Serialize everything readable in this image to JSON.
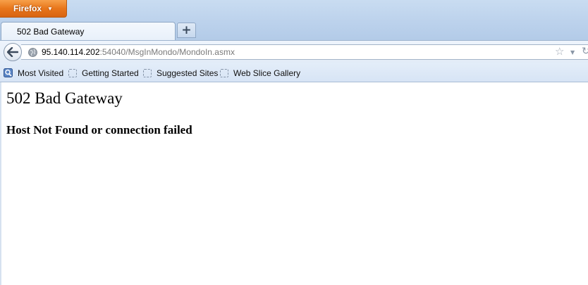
{
  "browser": {
    "menu_button_label": "Firefox",
    "accent_orange": "#e8761b"
  },
  "tabs": [
    {
      "title": "502 Bad Gateway"
    }
  ],
  "navbar": {
    "url_host": "95.140.114.202",
    "url_rest": ":54040/MsgInMondo/MondoIn.asmx"
  },
  "bookmarks": [
    {
      "label": "Most Visited",
      "icon": "most-visited-icon"
    },
    {
      "label": "Getting Started",
      "icon": "bookmark-placeholder-icon"
    },
    {
      "label": "Suggested Sites",
      "icon": "bookmark-placeholder-icon"
    },
    {
      "label": "Web Slice Gallery",
      "icon": "bookmark-placeholder-icon"
    }
  ],
  "page": {
    "heading": "502 Bad Gateway",
    "subheading": "Host Not Found or connection failed"
  }
}
